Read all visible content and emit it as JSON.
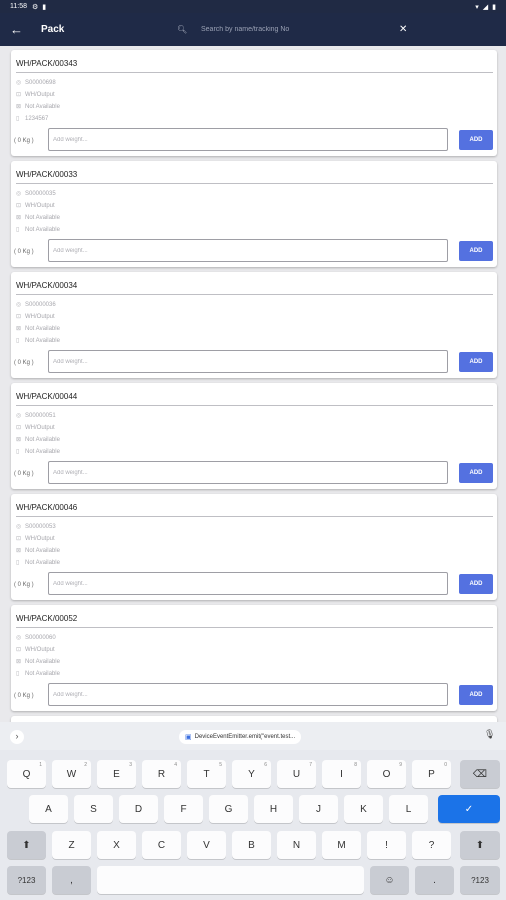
{
  "status_bar": {
    "time": "11:58"
  },
  "appbar": {
    "title": "Pack",
    "search_placeholder": "Search by name/tracking No"
  },
  "cards": [
    {
      "title": "WH/PACK/00343",
      "so": "S00000698",
      "location": "WH/Output",
      "field3": "Not Available",
      "field4": "1234567",
      "weight_label": "( 0 Kg )",
      "weight_placeholder": "Add weight...",
      "add_label": "ADD"
    },
    {
      "title": "WH/PACK/00033",
      "so": "S00000035",
      "location": "WH/Output",
      "field3": "Not Available",
      "field4": "Not Available",
      "weight_label": "( 0 Kg )",
      "weight_placeholder": "Add weight...",
      "add_label": "ADD"
    },
    {
      "title": "WH/PACK/00034",
      "so": "S00000036",
      "location": "WH/Output",
      "field3": "Not Available",
      "field4": "Not Available",
      "weight_label": "( 0 Kg )",
      "weight_placeholder": "Add weight...",
      "add_label": "ADD"
    },
    {
      "title": "WH/PACK/00044",
      "so": "S00000051",
      "location": "WH/Output",
      "field3": "Not Available",
      "field4": "Not Available",
      "weight_label": "( 0 Kg )",
      "weight_placeholder": "Add weight...",
      "add_label": "ADD"
    },
    {
      "title": "WH/PACK/00046",
      "so": "S00000053",
      "location": "WH/Output",
      "field3": "Not Available",
      "field4": "Not Available",
      "weight_label": "( 0 Kg )",
      "weight_placeholder": "Add weight...",
      "add_label": "ADD"
    },
    {
      "title": "WH/PACK/00052",
      "so": "S00000060",
      "location": "WH/Output",
      "field3": "Not Available",
      "field4": "Not Available",
      "weight_label": "( 0 Kg )",
      "weight_placeholder": "Add weight...",
      "add_label": "ADD"
    }
  ],
  "keyboard": {
    "suggestion": "DeviceEventEmitter.emit(\"event.test...",
    "row1": [
      {
        "label": "Q",
        "alt": "1"
      },
      {
        "label": "W",
        "alt": "2"
      },
      {
        "label": "E",
        "alt": "3"
      },
      {
        "label": "R",
        "alt": "4"
      },
      {
        "label": "T",
        "alt": "5"
      },
      {
        "label": "Y",
        "alt": "6"
      },
      {
        "label": "U",
        "alt": "7"
      },
      {
        "label": "I",
        "alt": "8"
      },
      {
        "label": "O",
        "alt": "9"
      },
      {
        "label": "P",
        "alt": "0"
      }
    ],
    "row2": [
      "A",
      "S",
      "D",
      "F",
      "G",
      "H",
      "J",
      "K",
      "L"
    ],
    "row3": [
      "Z",
      "X",
      "C",
      "V",
      "B",
      "N",
      "M",
      "!",
      "?"
    ],
    "symbols_label": "?123",
    "comma_label": ",",
    "period_label": ".",
    "enter_symbol": "✓",
    "shift_symbol": "⬆",
    "backspace_symbol": "⌫",
    "emoji_symbol": "☺"
  }
}
